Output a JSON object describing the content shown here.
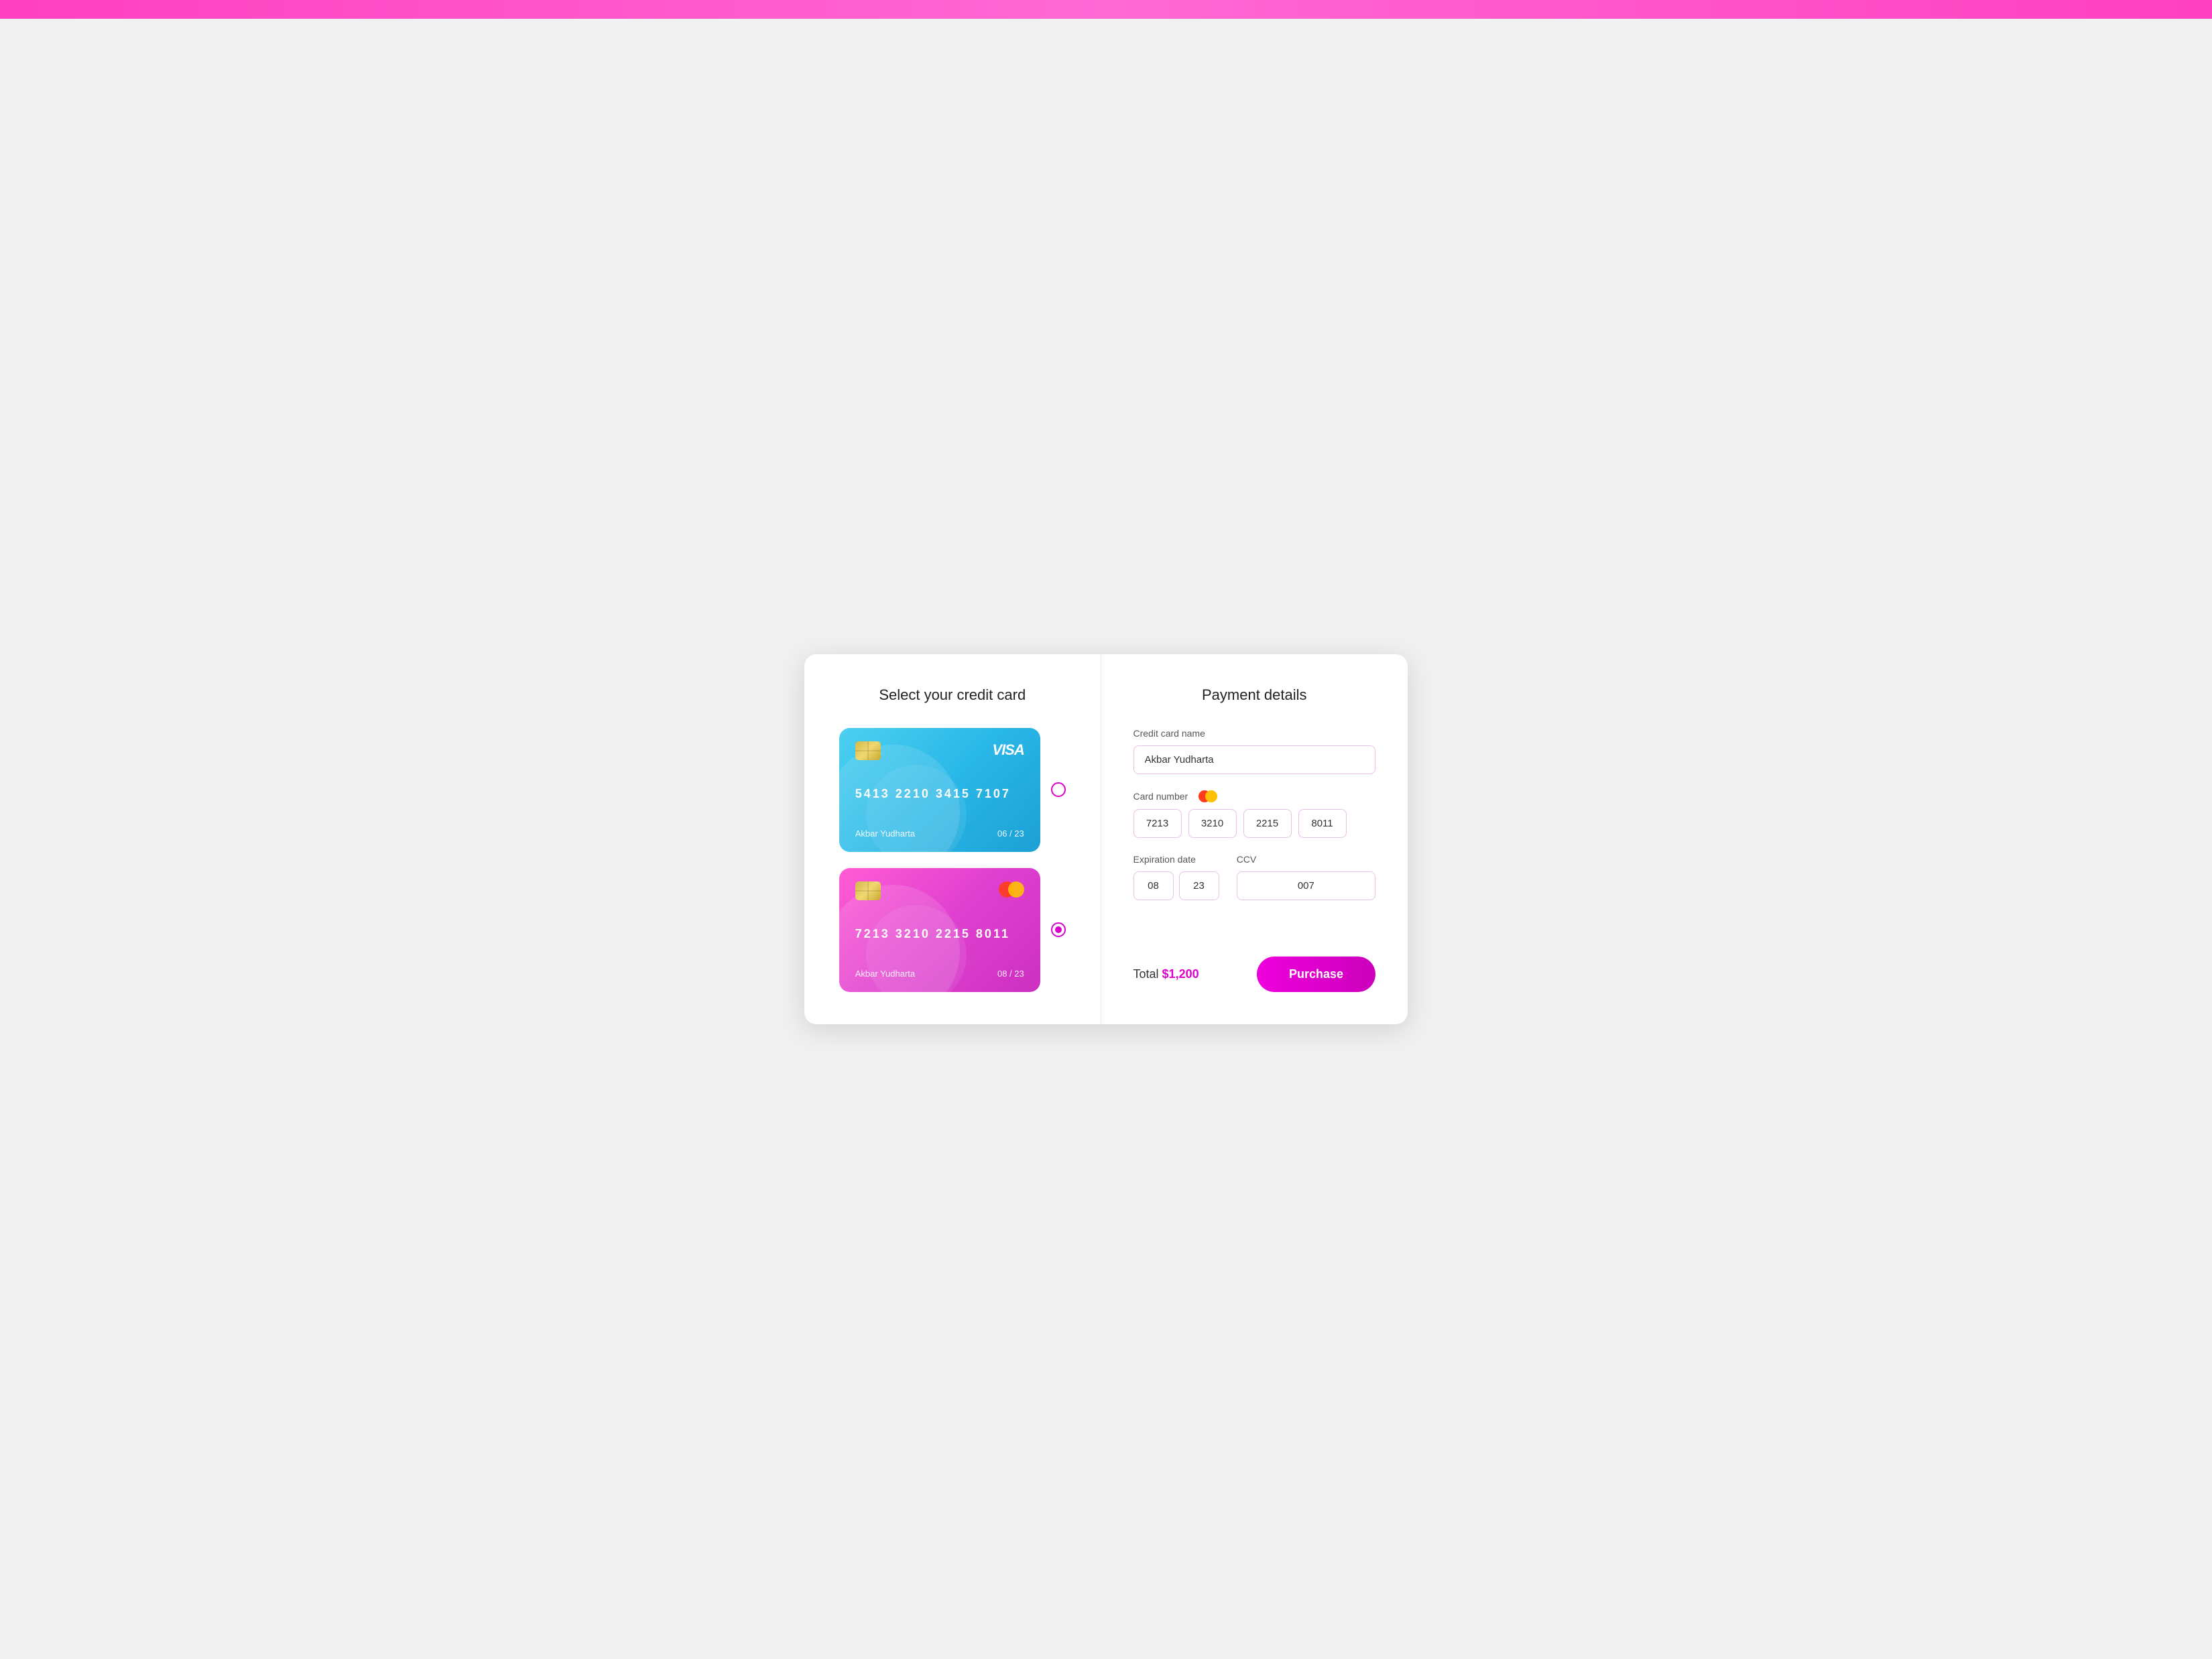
{
  "topbar": {
    "color": "#ff40c0"
  },
  "left_panel": {
    "title": "Select your credit card",
    "cards": [
      {
        "id": "visa",
        "type": "visa",
        "number": "5413  2210  3415  7107",
        "holder": "Akbar Yudharta",
        "expiry": "06 / 23",
        "selected": false
      },
      {
        "id": "mastercard",
        "type": "mastercard",
        "number": "7213  3210  2215  8011",
        "holder": "Akbar Yudharta",
        "expiry": "08 / 23",
        "selected": true
      }
    ]
  },
  "right_panel": {
    "title": "Payment details",
    "fields": {
      "credit_card_name_label": "Credit card name",
      "credit_card_name_value": "Akbar Yudharta",
      "card_number_label": "Card number",
      "card_number_1": "7213",
      "card_number_2": "3210",
      "card_number_3": "2215",
      "card_number_4": "8011",
      "expiration_date_label": "Expiration date",
      "exp_month": "08",
      "exp_year": "23",
      "ccv_label": "CCV",
      "ccv_value": "007"
    },
    "total_label": "Total",
    "total_amount": "$1,200",
    "purchase_button": "Purchase"
  }
}
